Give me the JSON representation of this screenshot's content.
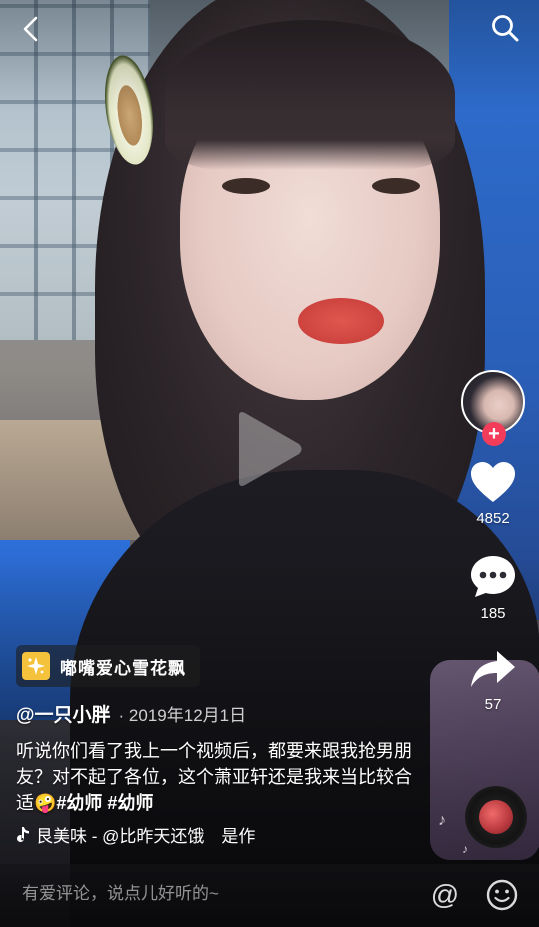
{
  "topbar": {
    "back_icon": "chevron-left-icon",
    "search_icon": "search-icon"
  },
  "player": {
    "state_icon": "play-icon"
  },
  "rail": {
    "follow_symbol": "+",
    "like_count": "4852",
    "comment_count": "185",
    "share_count": "57"
  },
  "sticker": {
    "label": "嘟嘴爱心雪花飘"
  },
  "post": {
    "author": "@一只小胖",
    "date": "· 2019年12月1日",
    "caption_text": "听说你们看了我上一个视频后，都要来跟我抢男朋友？对不起了各位，这个萧亚轩还是我来当比较合适",
    "caption_emoji": "🤪",
    "hashtags": "#幼师 #幼师"
  },
  "music": {
    "text": "艮美味 - @比昨天还饿　是作"
  },
  "comment_bar": {
    "placeholder": "有爱评论，说点儿好听的~",
    "at_symbol": "@"
  },
  "colors": {
    "accent_red": "#f23c5a",
    "sticker_yellow": "#f5c23c"
  }
}
